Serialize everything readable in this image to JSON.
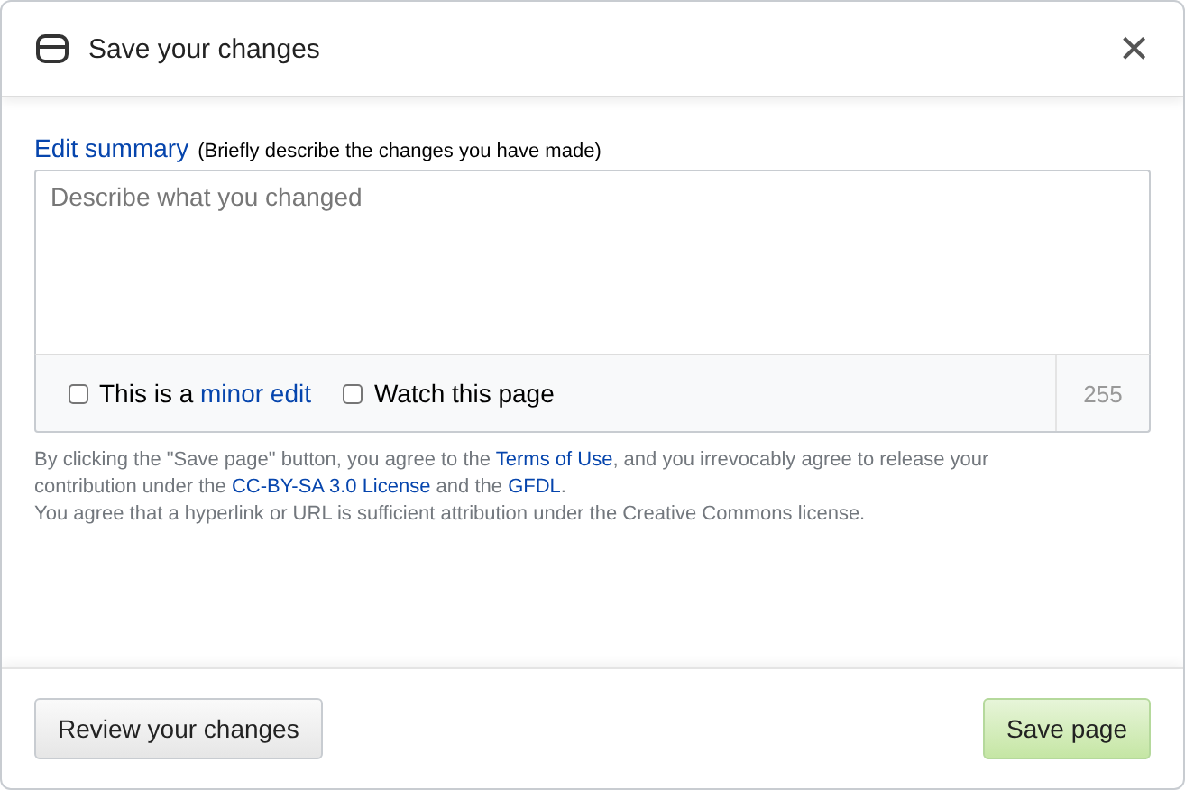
{
  "dialog": {
    "title": "Save your changes",
    "close": "×"
  },
  "summary": {
    "label": "Edit summary",
    "hint": "(Briefly describe the changes you have made)",
    "placeholder": "Describe what you changed",
    "remaining": "255"
  },
  "options": [
    {
      "parts": [
        {
          "kind": "text",
          "text": "This is a "
        },
        {
          "kind": "link",
          "text": "minor edit"
        }
      ],
      "checked": false
    },
    {
      "parts": [
        {
          "kind": "text",
          "text": "Watch this page"
        }
      ],
      "checked": false
    }
  ],
  "legal": [
    [
      {
        "kind": "text",
        "text": "By clicking the \"Save page\" button, you agree to the "
      },
      {
        "kind": "link",
        "text": "Terms of Use"
      },
      {
        "kind": "text",
        "text": ", and you irrevocably agree to release your contribution under the "
      },
      {
        "kind": "link",
        "text": "CC-BY-SA 3.0 License"
      },
      {
        "kind": "text",
        "text": " and the "
      },
      {
        "kind": "link",
        "text": "GFDL"
      },
      {
        "kind": "text",
        "text": "."
      }
    ],
    [
      {
        "kind": "text",
        "text": "You agree that a hyperlink or URL is sufficient attribution under the Creative Commons license."
      }
    ]
  ],
  "buttons": [
    {
      "label": "Review your changes",
      "kind": "secondary"
    },
    {
      "label": "Save page",
      "kind": "primary"
    }
  ]
}
